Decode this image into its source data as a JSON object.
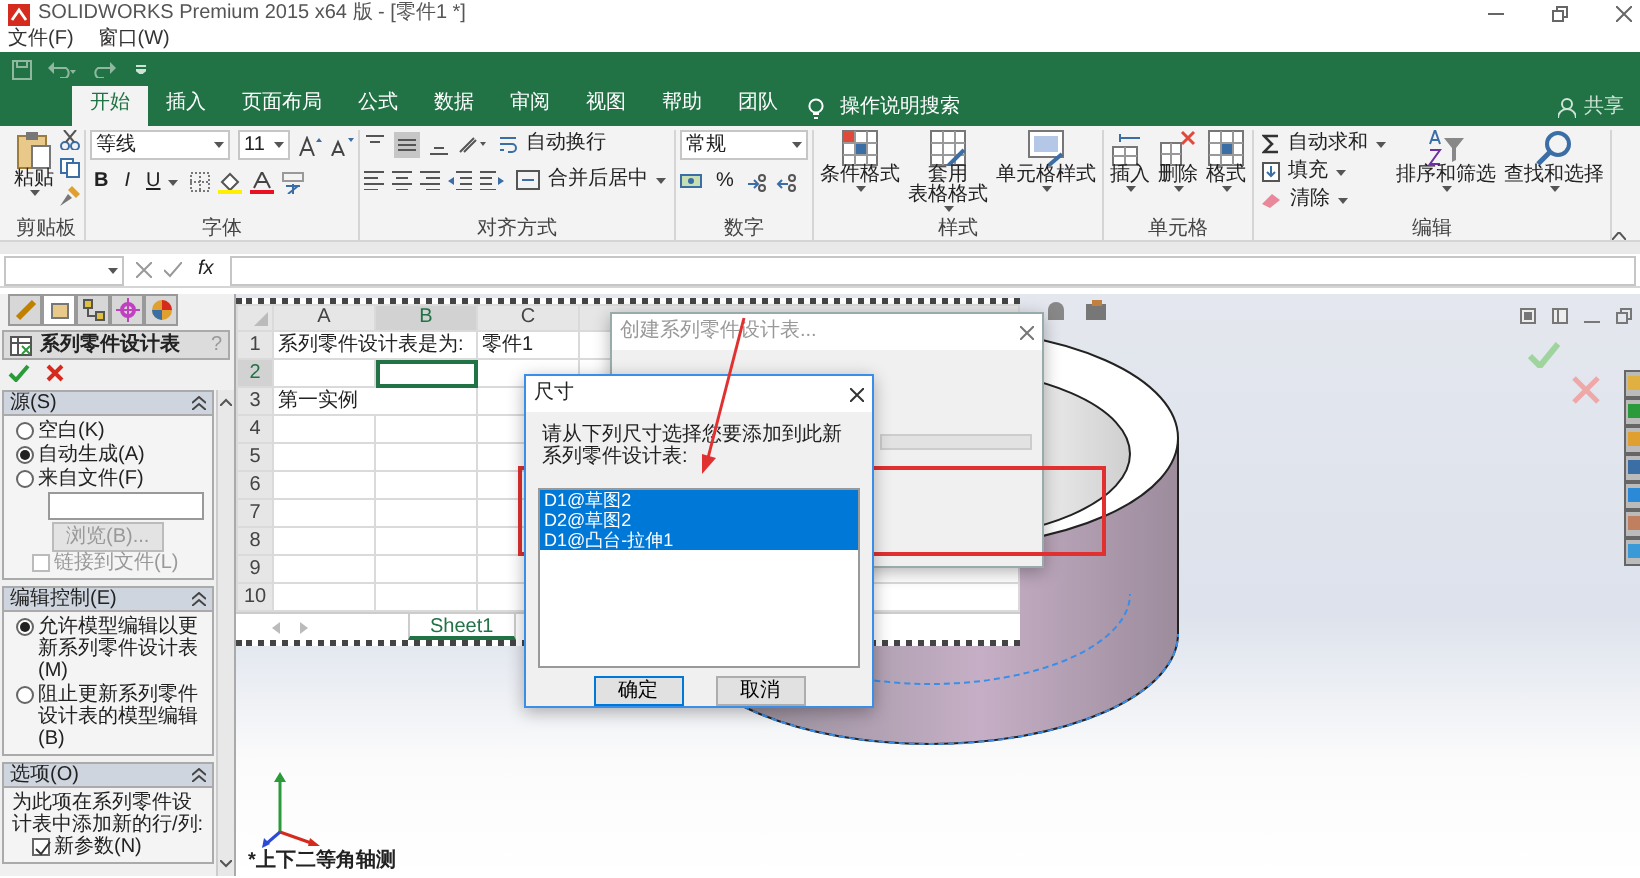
{
  "window": {
    "title": "SOLIDWORKS Premium 2015 x64 版 - [零件1 *]"
  },
  "menu": [
    "文件(F)",
    "窗口(W)"
  ],
  "ribbon_tabs": [
    {
      "label": "开始",
      "selected": true
    },
    {
      "label": "插入",
      "selected": false
    },
    {
      "label": "页面布局",
      "selected": false
    },
    {
      "label": "公式",
      "selected": false
    },
    {
      "label": "数据",
      "selected": false
    },
    {
      "label": "审阅",
      "selected": false
    },
    {
      "label": "视图",
      "selected": false
    },
    {
      "label": "帮助",
      "selected": false
    },
    {
      "label": "团队",
      "selected": false
    }
  ],
  "tell_me": "操作说明搜索",
  "share": "共享",
  "ribbon_groups": [
    {
      "kind": "clipboard",
      "label": "剪贴板",
      "paste": "粘贴"
    },
    {
      "kind": "font",
      "label": "字体",
      "font_name": "等线",
      "font_size": "11",
      "bold": "B",
      "italic": "I",
      "underline": "U"
    },
    {
      "kind": "alignment",
      "label": "对齐方式",
      "wrap": "自动换行",
      "merge": "合并后居中"
    },
    {
      "kind": "number",
      "label": "数字",
      "format": "常规",
      "percent": "%"
    },
    {
      "kind": "styles",
      "label": "样式",
      "buttons": [
        {
          "lines": [
            "条件格式"
          ]
        },
        {
          "lines": [
            "套用",
            "表格格式"
          ]
        },
        {
          "lines": [
            "单元格样式"
          ]
        }
      ]
    },
    {
      "kind": "cells",
      "label": "单元格",
      "buttons": [
        {
          "lines": [
            "插入"
          ]
        },
        {
          "lines": [
            "删除"
          ]
        },
        {
          "lines": [
            "格式"
          ]
        }
      ]
    },
    {
      "kind": "editing",
      "label": "编辑",
      "autosum": "自动求和",
      "fill": "填充",
      "clear": "清除",
      "buttons": [
        {
          "lines": [
            "排序和筛选"
          ]
        },
        {
          "lines": [
            "查找和选择"
          ]
        }
      ]
    }
  ],
  "formula_bar": {
    "function_button": "fx"
  },
  "property_manager": {
    "panel_tabs": [
      {
        "selected": false
      },
      {
        "selected": true
      },
      {
        "selected": false
      },
      {
        "selected": false
      },
      {
        "selected": false
      }
    ],
    "title": "系列零件设计表",
    "help": "?",
    "sections": [
      {
        "title": "源(S)",
        "expanded": true,
        "items": [
          {
            "kind": "radio",
            "label": "空白(K)",
            "selected": false
          },
          {
            "kind": "radio",
            "label": "自动生成(A)",
            "selected": true
          },
          {
            "kind": "radio",
            "label": "来自文件(F)",
            "selected": false
          },
          {
            "kind": "field"
          },
          {
            "kind": "button",
            "label": "浏览(B)...",
            "disabled": true
          },
          {
            "kind": "checkbox",
            "label": "链接到文件(L)",
            "checked": false,
            "disabled": true
          }
        ]
      },
      {
        "title": "编辑控制(E)",
        "expanded": true,
        "items": [
          {
            "kind": "radio",
            "label": "允许模型编辑以更新系列零件设计表(M)",
            "selected": true
          },
          {
            "kind": "radio",
            "label": "阻止更新系列零件设计表的模型编辑(B)",
            "selected": false
          }
        ]
      },
      {
        "title": "选项(O)",
        "expanded": true,
        "items": [
          {
            "kind": "text",
            "label": "为此项在系列零件设计表中添加新的行/列:"
          },
          {
            "kind": "checkbox",
            "label": "新参数(N)",
            "checked": true,
            "disabled": false
          }
        ]
      }
    ]
  },
  "spreadsheet": {
    "columns": [
      "A",
      "B",
      "C"
    ],
    "rows": [
      {
        "header": "1",
        "cells": [
          {
            "text": "系列零件设计表是为:",
            "selected": false,
            "colspan": 2
          },
          {
            "text": "零件1",
            "selected": false
          }
        ]
      },
      {
        "header": "2",
        "cells": [
          {
            "selected": false
          },
          {
            "selected": true
          },
          {
            "selected": false
          }
        ]
      },
      {
        "header": "3",
        "cells": [
          {
            "text": "第一实例",
            "selected": false,
            "colspan": 2
          },
          {
            "selected": false
          }
        ]
      },
      {
        "header": "4",
        "cells": [
          {
            "selected": false
          },
          {
            "selected": false
          },
          {
            "selected": false
          }
        ]
      },
      {
        "header": "5",
        "cells": [
          {
            "selected": false
          },
          {
            "selected": false
          },
          {
            "selected": false
          }
        ]
      },
      {
        "header": "6",
        "cells": [
          {
            "selected": false
          },
          {
            "selected": false
          },
          {
            "selected": false
          }
        ]
      },
      {
        "header": "7",
        "cells": [
          {
            "selected": false
          },
          {
            "selected": false
          },
          {
            "selected": false
          }
        ]
      },
      {
        "header": "8",
        "cells": [
          {
            "selected": false
          },
          {
            "selected": false
          },
          {
            "selected": false
          }
        ]
      },
      {
        "header": "9",
        "cells": [
          {
            "selected": false
          },
          {
            "selected": false
          },
          {
            "selected": false
          }
        ]
      },
      {
        "header": "10",
        "cells": [
          {
            "selected": false
          },
          {
            "selected": false
          },
          {
            "selected": false
          }
        ]
      }
    ],
    "sheet_tabs": [
      {
        "label": "Sheet1",
        "selected": true
      }
    ]
  },
  "background_dialog": {
    "title": "创建系列零件设计表..."
  },
  "dimension_dialog": {
    "title": "尺寸",
    "prompt": "请从下列尺寸选择您要添加到此新系列零件设计表:",
    "items": [
      {
        "label": "D1@草图2",
        "selected": true
      },
      {
        "label": "D2@草图2",
        "selected": true
      },
      {
        "label": "D1@凸台-拉伸1",
        "selected": true
      }
    ],
    "buttons": [
      "确定",
      "取消"
    ]
  },
  "viewport": {
    "view_label": "*上下二等角轴测"
  }
}
